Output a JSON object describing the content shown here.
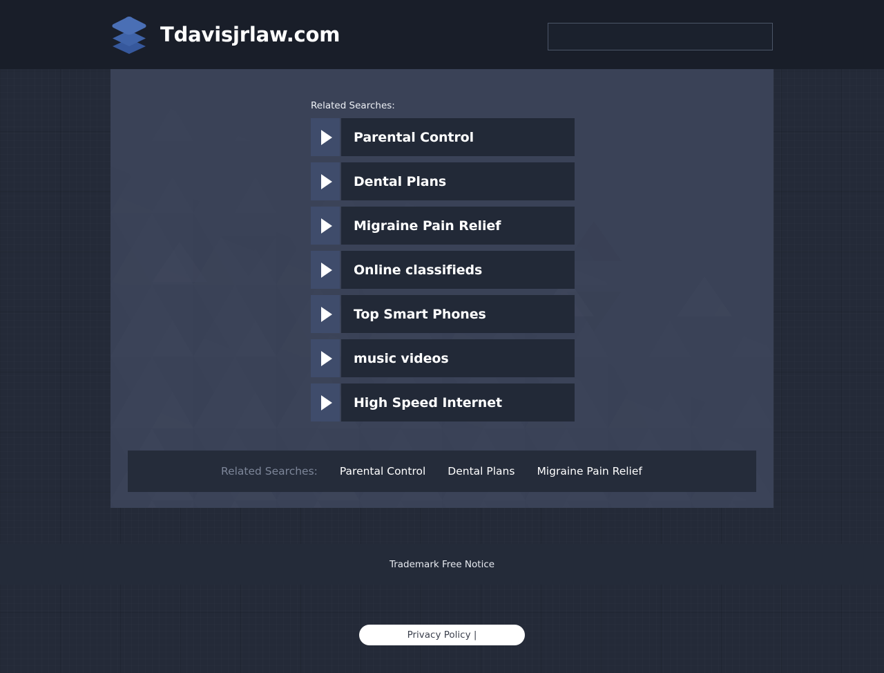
{
  "header": {
    "brand_title": "Tdavisjrlaw.com",
    "logo_icon": "stacked-layers-icon",
    "logo_colors": {
      "top": "#4a6fb5",
      "middle": "#3f63a8",
      "bottom": "#36589c"
    },
    "search": {
      "value": "",
      "placeholder": ""
    }
  },
  "main": {
    "related_label": "Related Searches:",
    "items": [
      {
        "label": "Parental Control",
        "icon": "play-triangle-icon"
      },
      {
        "label": "Dental Plans",
        "icon": "play-triangle-icon"
      },
      {
        "label": "Migraine Pain Relief",
        "icon": "play-triangle-icon"
      },
      {
        "label": "Online classifieds",
        "icon": "play-triangle-icon"
      },
      {
        "label": "Top Smart Phones",
        "icon": "play-triangle-icon"
      },
      {
        "label": "music videos",
        "icon": "play-triangle-icon"
      },
      {
        "label": "High Speed Internet",
        "icon": "play-triangle-icon"
      }
    ],
    "related_bar": {
      "label": "Related Searches:",
      "links": [
        "Parental Control",
        "Dental Plans",
        "Migraine Pain Relief"
      ]
    }
  },
  "footer": {
    "notice": "Trademark Free Notice",
    "privacy_label": "Privacy Policy |"
  },
  "colors": {
    "page_bg": "#242a38",
    "header_bg": "#191e29",
    "panel_bg": "#3a4257",
    "row_icon_bg": "#3f4c6b",
    "row_body_bg": "#222937",
    "related_bar_bg": "#252c3a",
    "notice_band_bg": "#242b39",
    "pill_bg": "#ffffff",
    "muted_text": "#7d8699"
  }
}
